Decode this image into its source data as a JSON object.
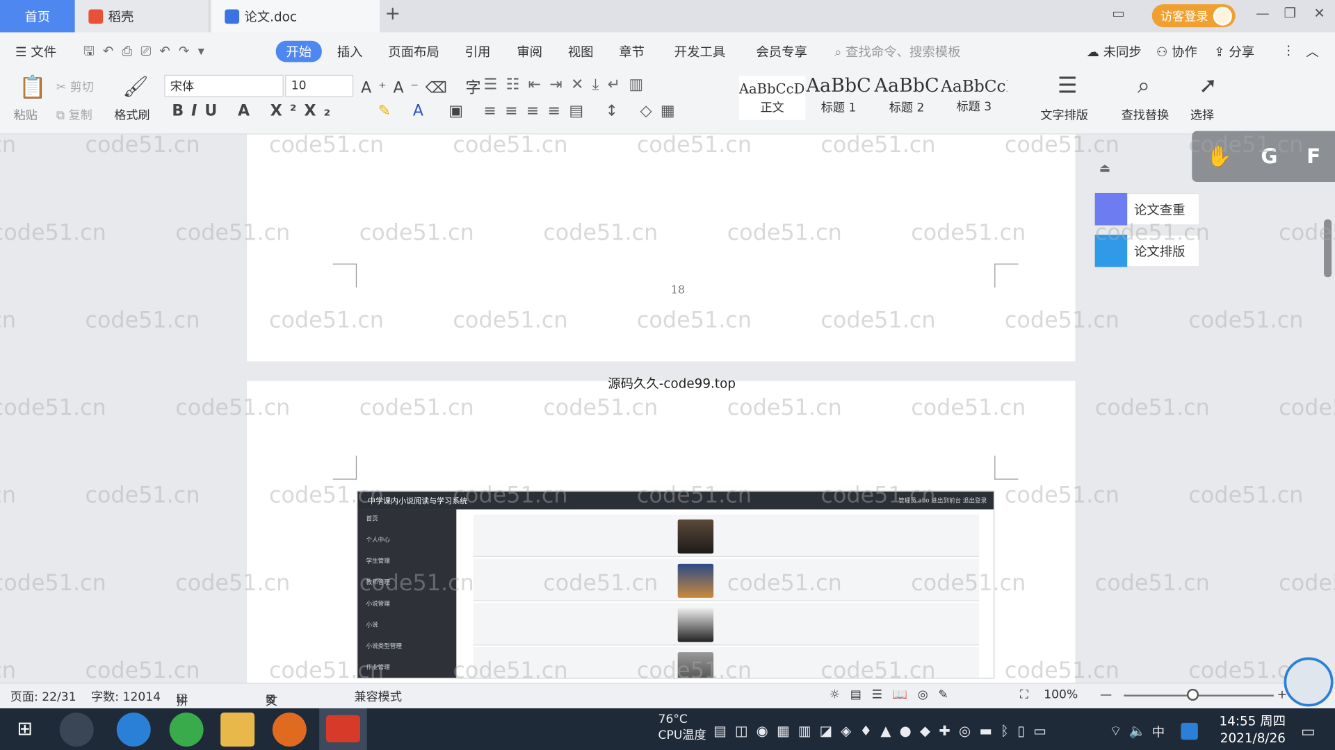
{
  "tabs": {
    "home": "首页",
    "daoke": "稻壳",
    "doc": "论文.doc",
    "login": "访客登录"
  },
  "menu": {
    "file": "文件",
    "items": [
      "开始",
      "插入",
      "页面布局",
      "引用",
      "审阅",
      "视图",
      "章节",
      "开发工具",
      "会员专享"
    ],
    "search": "查找命令、搜索模板",
    "sync": "未同步",
    "collab": "协作",
    "share": "分享"
  },
  "ribbon": {
    "paste": "粘贴",
    "cut": "剪切",
    "copy": "复制",
    "format_painter": "格式刷",
    "font": "宋体",
    "size": "10",
    "styles": [
      {
        "sample": "AaBbCcDd",
        "label": "正文"
      },
      {
        "sample": "AaBbC",
        "label": "标题 1"
      },
      {
        "sample": "AaBbC",
        "label": "标题 2"
      },
      {
        "sample": "AaBbCcI",
        "label": "标题 3"
      }
    ],
    "text_layout": "文字排版",
    "find_replace": "查找替换",
    "select": "选择"
  },
  "side": {
    "check": "论文查重",
    "layout": "论文排版"
  },
  "doc": {
    "page_number": "18",
    "header_text": "源码久久-code99.top",
    "watermark": "code51.cn",
    "shot_title": "中学课内小说阅读与学习系统",
    "shot_top_right": [
      "管理员 abo",
      "进出到前台",
      "退出登录"
    ],
    "shot_menu": [
      "首页",
      "个人中心",
      "学生管理",
      "教师管理",
      "小说管理",
      "小说",
      "小说类型管理",
      "作业管理"
    ]
  },
  "status": {
    "page": "页面: 22/31",
    "words": "字数: 12014",
    "spell": "拼写检查",
    "proof": "文档校对",
    "compat": "兼容模式",
    "zoom": "100%"
  },
  "taskbar": {
    "temp": "76°C",
    "cpu": "CPU温度",
    "ime": "中",
    "time": "14:55 周四",
    "date": "2021/8/26"
  }
}
